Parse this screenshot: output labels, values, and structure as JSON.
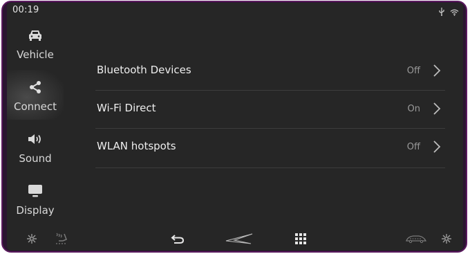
{
  "status": {
    "time": "00:19",
    "icons": [
      "usb-icon",
      "wifi-icon"
    ]
  },
  "sidebar": {
    "items": [
      {
        "label": "Vehicle",
        "icon": "car-icon",
        "active": false
      },
      {
        "label": "Connect",
        "icon": "share-icon",
        "active": true
      },
      {
        "label": "Sound",
        "icon": "speaker-icon",
        "active": false
      },
      {
        "label": "Display",
        "icon": "monitor-icon",
        "active": false
      }
    ]
  },
  "settings": {
    "rows": [
      {
        "title": "Bluetooth Devices",
        "value": "Off"
      },
      {
        "title": "Wi-Fi Direct",
        "value": "On"
      },
      {
        "title": "WLAN hotspots",
        "value": "Off"
      }
    ]
  },
  "bottombar": {
    "icons": [
      "fan-left-icon",
      "seat-heat-icon",
      "back-icon",
      "brand-logo-icon",
      "apps-grid-icon",
      "car-air-icon",
      "fan-right-icon"
    ]
  },
  "colors": {
    "background": "#262626",
    "text": "#eeeeee",
    "muted": "#9a9a9a",
    "bezel": "#5a1a5e"
  }
}
